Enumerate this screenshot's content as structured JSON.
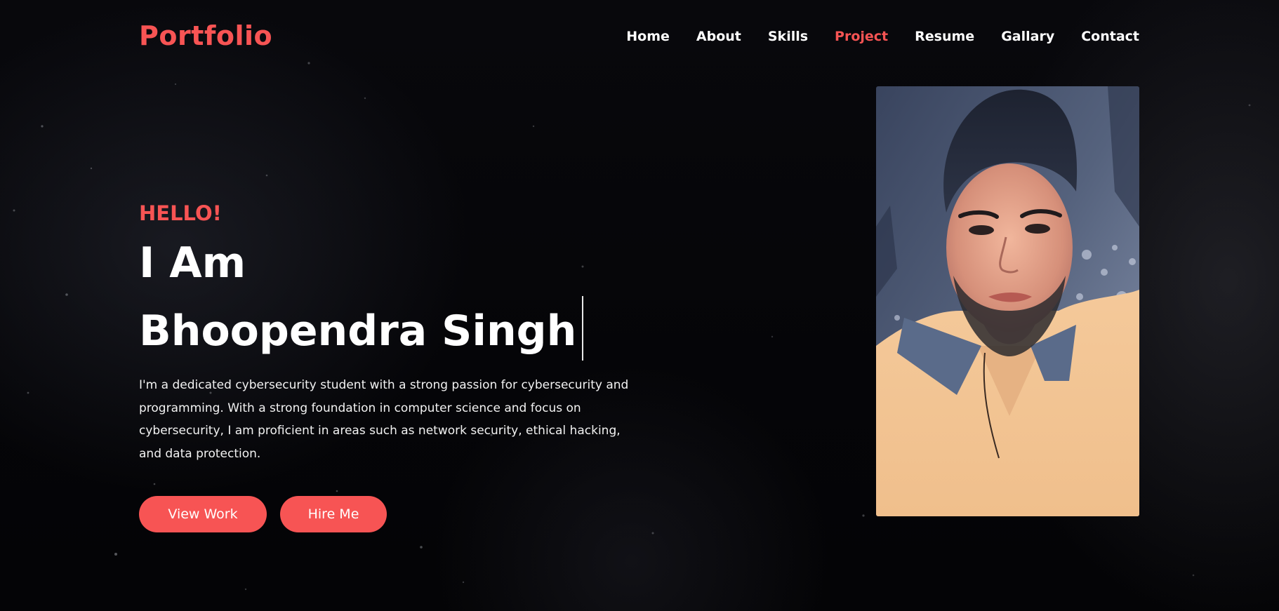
{
  "header": {
    "logo": "Portfolio",
    "nav": [
      {
        "label": "Home",
        "active": false
      },
      {
        "label": "About",
        "active": false
      },
      {
        "label": "Skills",
        "active": false
      },
      {
        "label": "Project",
        "active": true
      },
      {
        "label": "Resume",
        "active": false
      },
      {
        "label": "Gallary",
        "active": false
      },
      {
        "label": "Contact",
        "active": false
      }
    ]
  },
  "hero": {
    "greeting": "HELLO!",
    "title_line1": "I Am",
    "title_line2": "Bhoopendra Singh",
    "bio": "I'm a dedicated cybersecurity student with a strong passion for cybersecurity and programming. With a strong foundation in computer science and focus on cybersecurity, I am proficient in areas such as network security, ethical hacking, and data protection.",
    "buttons": {
      "view_work": "View Work",
      "hire_me": "Hire Me"
    }
  },
  "profile_photo": {
    "icon": "profile-portrait"
  },
  "colors": {
    "accent": "#f75454",
    "background": "#060609",
    "text": "#ffffff"
  }
}
